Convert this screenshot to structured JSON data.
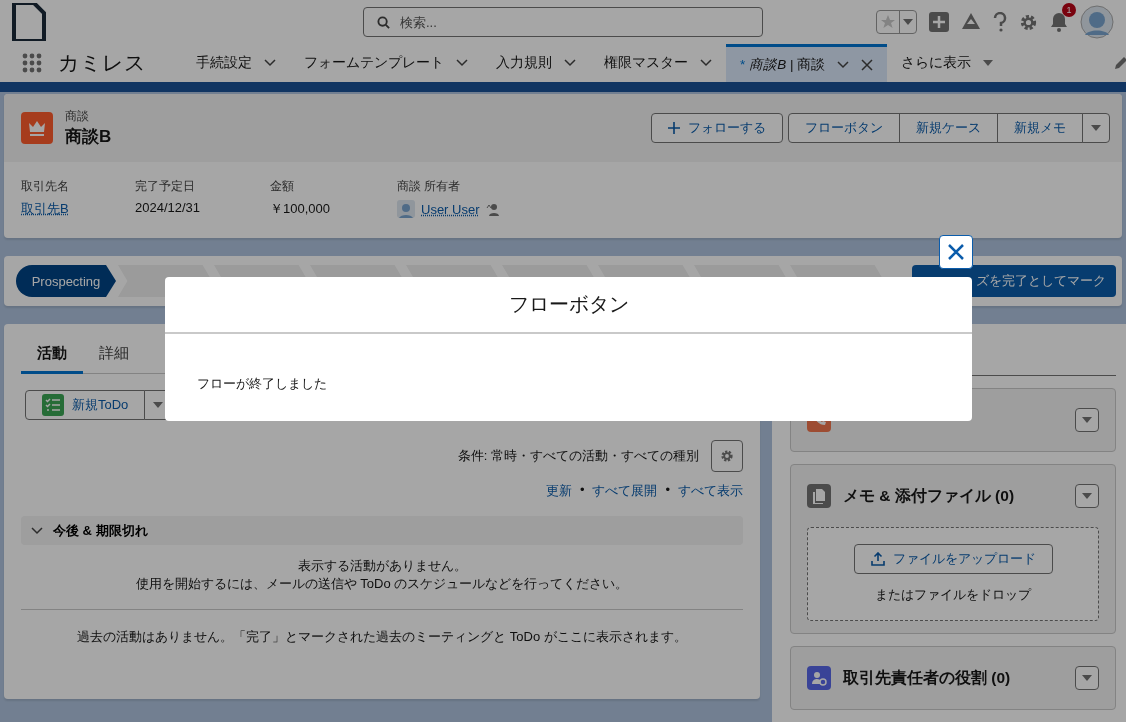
{
  "global_header": {
    "search": {
      "placeholder": "検索..."
    },
    "notification_count": "1"
  },
  "nav": {
    "app_name": "カミレス",
    "tabs": [
      {
        "label": "手続設定",
        "selected": false
      },
      {
        "label": "フォームテンプレート",
        "selected": false
      },
      {
        "label": "入力規則",
        "selected": false
      },
      {
        "label": "権限マスター",
        "selected": false
      },
      {
        "label": "*商談B* | 商談",
        "selected": true,
        "modified_mark": "*"
      }
    ],
    "more": "さらに表示"
  },
  "record": {
    "object_type": "商談",
    "name": "商談B",
    "follow": "フォローする",
    "actions": [
      "フローボタン",
      "新規ケース",
      "新規メモ"
    ],
    "fields": [
      {
        "label": "取引先名",
        "value": "取引先B",
        "kind": "link"
      },
      {
        "label": "完了予定日",
        "value": "2024/12/31",
        "kind": "text"
      },
      {
        "label": "金額",
        "value": "￥100,000",
        "kind": "text"
      },
      {
        "label": "商談 所有者",
        "value": "User User",
        "kind": "user"
      }
    ]
  },
  "path": {
    "stages": [
      {
        "label": "Prospecting",
        "selected": true
      },
      {
        "selected": false
      },
      {
        "selected": false
      },
      {
        "selected": false
      },
      {
        "selected": false
      },
      {
        "selected": false
      },
      {
        "selected": false
      },
      {
        "selected": false
      },
      {
        "selected": false
      }
    ],
    "mark_complete": "ズを完了としてマーク"
  },
  "activity": {
    "tabs": [
      {
        "label": "活動",
        "selected": true
      },
      {
        "label": "詳細",
        "selected": false
      }
    ],
    "new_todo": "新規ToDo",
    "filter": "条件: 常時・すべての活動・すべての種別",
    "links": [
      "更新",
      "すべて展開",
      "すべて表示"
    ],
    "link_separators": [
      "•",
      "•"
    ],
    "section": {
      "title": "今後 & 期限切れ",
      "expanded": true
    },
    "upcoming_empty": [
      "表示する活動がありません。",
      "使用を開始するには、メールの送信や ToDo のスケジュールなどを行ってください。"
    ],
    "past_empty": "過去の活動はありません。「完了」とマークされた過去のミーティングと ToDo がここに表示されます。"
  },
  "related": [
    {
      "kind": "calls"
    },
    {
      "kind": "files",
      "title": "メモ & 添付ファイル (0)",
      "upload": "ファイルをアップロード",
      "drop_hint": "またはファイルをドロップ"
    },
    {
      "kind": "contact_roles",
      "title": "取引先責任者の役割 (0)"
    }
  ],
  "modal": {
    "title": "フローボタン",
    "message": "フローが終了しました"
  }
}
